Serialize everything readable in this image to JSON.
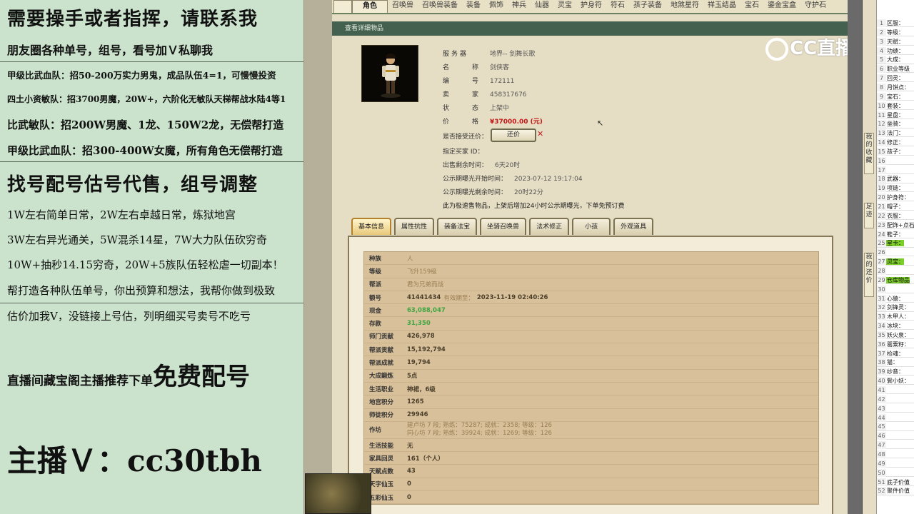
{
  "promo": {
    "l1": "需要操手或者指挥，请联系我",
    "l2": "朋友圈各种单号，组号，看号加Ｖ私聊我",
    "l3": "甲级比武血队：招50-200万实力男鬼，成品队伍4=1，可慢慢投资",
    "l4": "四土小资敏队：招3700男魔，20W+，六阶化无敏队天梯帮战水陆4等1",
    "l5": "比武敏队：招200W男魔、1龙、150W2龙，无偿帮打造",
    "l6": "甲级比武血队：招300-400W女魔，所有角色无偿帮打造",
    "l7": "找号配号估号代售，组号调整",
    "l8": "1W左右简单日常，2W左右卓越日常，炼狱地宫",
    "l9": "3W左右异光通关，5W混杀14星，7W大力队伍砍穷奇",
    "l10": "10W+抽秒14.15穷奇，20W+5族队伍轻松虐一切副本！",
    "l11": "帮打造各种队伍单号，你出预算和想法，我帮你做到极致",
    "l12": "估价加我V，没链接上号估，列明细买号卖号不吃亏",
    "l13a": "直播间藏宝阁主播推荐下单",
    "l13b": "免费配号",
    "host": "主播Ｖ：cc30tbh"
  },
  "top_tabs": [
    "角色",
    "召唤兽",
    "召唤兽装备",
    "装备",
    "佩饰",
    "神兵",
    "仙器",
    "灵宝",
    "护身符",
    "符石",
    "孩子装备",
    "地煞星符",
    "祥玉结晶",
    "宝石",
    "鎏金宝盒",
    "守护石"
  ],
  "header": "查看详细物品",
  "info": {
    "server_k": "服务器",
    "server_v": "地界-- 剑舞长歌",
    "name_k": "名称",
    "name_v": "剑侠客",
    "id_k": "编号",
    "id_v": "172111",
    "seller_k": "卖家",
    "seller_v": "458317676",
    "status_k": "状态",
    "status_v": "上架中",
    "price_k": "价格",
    "price_v": "¥37000.00 (元)",
    "counter_k": "是否接受还价：",
    "counter_btn": "还价",
    "buyer_k": "指定买家 ID：",
    "remain_k": "出售剩余时间：",
    "remain_v": "6天20时",
    "pub_start_k": "公示期曝光开始时间：",
    "pub_start_v": "2023-07-12 19:17:04",
    "pub_remain_k": "公示期曝光剩余时间：",
    "pub_remain_v": "20时22分",
    "notice": "此为极速售物品，上架后增加24小时公示期曝光，下单免预订费"
  },
  "subtabs": [
    "基本信息",
    "属性抗性",
    "装备法宝",
    "坐骑召唤兽",
    "法术修正",
    "小孩",
    "外观道具"
  ],
  "detail": {
    "race_k": "种族",
    "race_v": "人",
    "level_k": "等级",
    "level_v": "飞升159级",
    "faction_k": "帮派",
    "faction_v": "君为兄弟而战",
    "acc_k": "额号",
    "acc_v": "41441434",
    "acc_exp": "有效期至：",
    "acc_date": "2023-11-19 02:40:26",
    "cash_k": "现金",
    "cash_v": "63,088,047",
    "deposit_k": "存款",
    "deposit_v": "31,350",
    "school_contrib_k": "师门贡献",
    "school_contrib_v": "426,978",
    "gang_contrib_k": "帮派贡献",
    "gang_contrib_v": "15,192,794",
    "gang_achieve_k": "帮派成就",
    "gang_achieve_v": "19,794",
    "forge_k": "大成鍛炼",
    "forge_v": "5点",
    "life_job_k": "生活职业",
    "life_job_v": "神裙，6级",
    "palace_k": "地宫积分",
    "palace_v": "1265",
    "pk_k": "师徒积分",
    "pk_v": "29946",
    "workshop_k": "作坊",
    "workshop_1": "建卢坊 7 段; 熟练：75287; 成就：2358; 等级：126",
    "workshop_2": "同心坊 7 段; 熟练：39924; 成就：1269; 等级：126",
    "life_skill_k": "生活技能",
    "life_skill_v": "无",
    "home_k": "家具回灵",
    "home_v": "161（个人）",
    "talent_k": "天赋点数",
    "talent_v": "43",
    "xian1_k": "天字仙玉",
    "xian1_v": "0",
    "xian2_k": "五彩仙玉",
    "xian2_v": "0"
  },
  "logo": "CC直播",
  "rtabs": [
    "我的收藏",
    "足迹",
    "我的还价"
  ],
  "sheet": [
    "区服：",
    "等级：",
    "天赋：",
    "功绩：",
    "大成：",
    "职业等级",
    "回灵：",
    "月饼点：",
    "宝石：",
    "套装：",
    "星盘：",
    "坐骑：",
    "法门：",
    "修正：",
    "孩子：",
    "",
    "",
    "武器：",
    "项链：",
    "护身符：",
    "帽子：",
    "衣服：",
    "配饰+点石",
    "鞋子：",
    "星卡：",
    "",
    "灵宝：",
    "",
    "仓库物品",
    "",
    "心猿：",
    "剑锋灵：",
    "木甲人：",
    "冰块：",
    "妖火泉：",
    "罂粟籽：",
    "检魂：",
    "猫：",
    "纱音：",
    "鬓小妖：",
    "",
    "",
    "",
    "",
    "",
    "",
    "",
    "",
    "",
    "",
    "底子价值",
    "聚件价值"
  ]
}
